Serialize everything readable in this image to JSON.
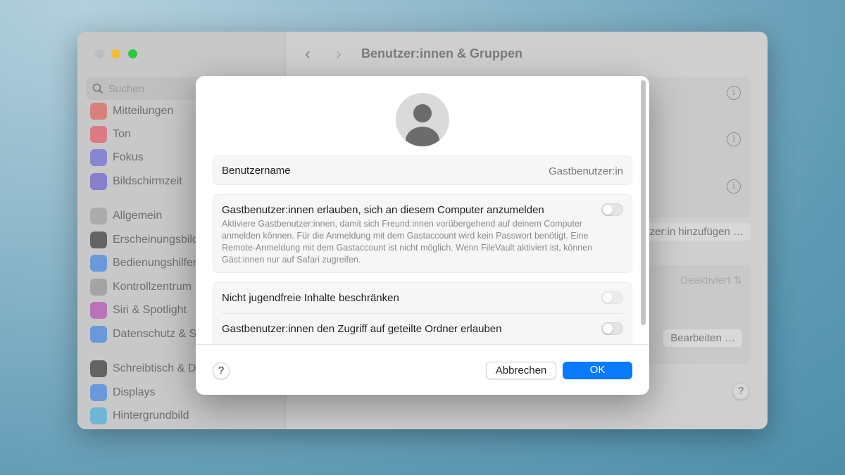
{
  "window": {
    "title": "Benutzer:innen & Gruppen",
    "search_placeholder": "Suchen"
  },
  "sidebar": {
    "items": [
      {
        "label": "Mitteilungen",
        "color": "#e0514a"
      },
      {
        "label": "Ton",
        "color": "#e8485a"
      },
      {
        "label": "Fokus",
        "color": "#5d5ad8"
      },
      {
        "label": "Bildschirmzeit",
        "color": "#5d4fd0"
      },
      {
        "label": "Allgemein",
        "color": "#9a9a9a"
      },
      {
        "label": "Erscheinungsbild",
        "color": "#222222"
      },
      {
        "label": "Bedienungshilfen",
        "color": "#2a7ae8"
      },
      {
        "label": "Kontrollzentrum",
        "color": "#8c8c8c"
      },
      {
        "label": "Siri & Spotlight",
        "color": "#b03ab0"
      },
      {
        "label": "Datenschutz & Sicherheit",
        "color": "#2a7ae8"
      },
      {
        "label": "Schreibtisch & Dock",
        "color": "#222222"
      },
      {
        "label": "Displays",
        "color": "#2a7ae8"
      },
      {
        "label": "Hintergrundbild",
        "color": "#34aadc"
      }
    ]
  },
  "background": {
    "add_user_button": "Benutzer:in hinzufügen …",
    "auto_login_value": "Deaktiviert",
    "edit_button": "Bearbeiten …",
    "help": "?"
  },
  "dialog": {
    "username_label": "Benutzername",
    "username_value": "Gastbenutzer:in",
    "allow_guest": {
      "label": "Gastbenutzer:innen erlauben, sich an diesem Computer anzumelden",
      "description": "Aktiviere Gastbenutzer:innen, damit sich Freund:innen vorübergehend auf deinem Computer anmelden können. Für die Anmeldung mit dem Gastaccount wird kein Passwort benötigt. Eine Remote-Anmeldung mit dem Gastaccount ist nicht möglich. Wenn FileVault aktiviert ist, können Gäst:innen nur auf Safari zugreifen.",
      "on": false
    },
    "restrict_adult": {
      "label": "Nicht jugendfreie Inhalte beschränken",
      "on": false,
      "enabled": false
    },
    "shared_folders": {
      "label": "Gastbenutzer:innen den Zugriff auf geteilte Ordner erlauben",
      "on": false
    },
    "help": "?",
    "cancel": "Abbrechen",
    "ok": "OK",
    "accent": "#0a7aff"
  }
}
